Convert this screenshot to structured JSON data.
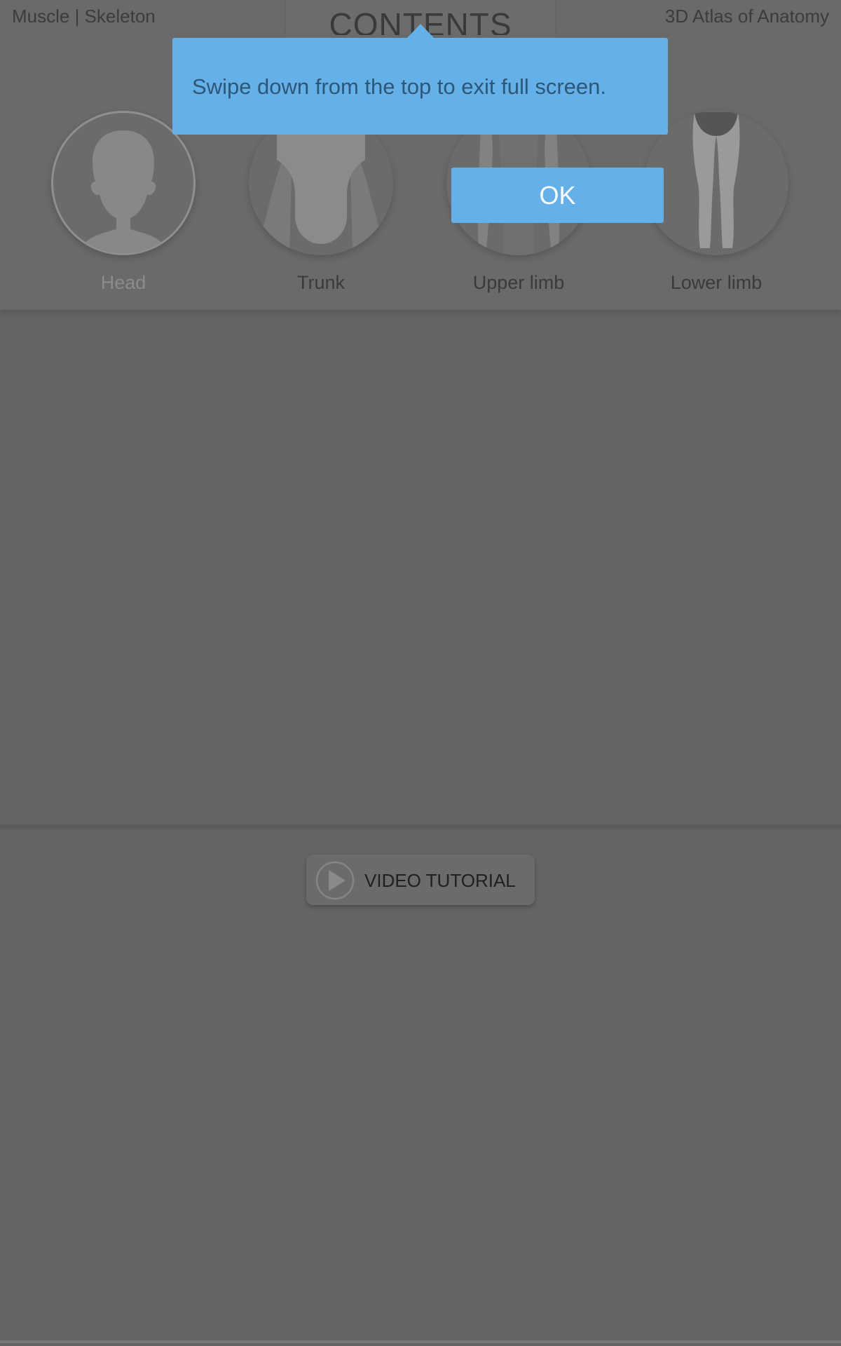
{
  "header": {
    "left_label": "Muscle | Skeleton",
    "title": "CONTENTS",
    "right_label": "3D Atlas of Anatomy",
    "close_icon": "close-icon"
  },
  "categories": [
    {
      "label": "Head",
      "selected": true,
      "icon": "head-silhouette-icon"
    },
    {
      "label": "Trunk",
      "selected": false,
      "icon": "trunk-icon"
    },
    {
      "label": "Upper limb",
      "selected": false,
      "icon": "upper-limb-icon"
    },
    {
      "label": "Lower limb",
      "selected": false,
      "icon": "lower-limb-icon"
    }
  ],
  "video": {
    "label": "VIDEO TUTORIAL",
    "icon": "play-icon"
  },
  "popup": {
    "message": "Swipe down from the top to exit full screen.",
    "ok_label": "OK"
  },
  "colors": {
    "accent": "#64b0e8",
    "dim_background": "#646464"
  }
}
